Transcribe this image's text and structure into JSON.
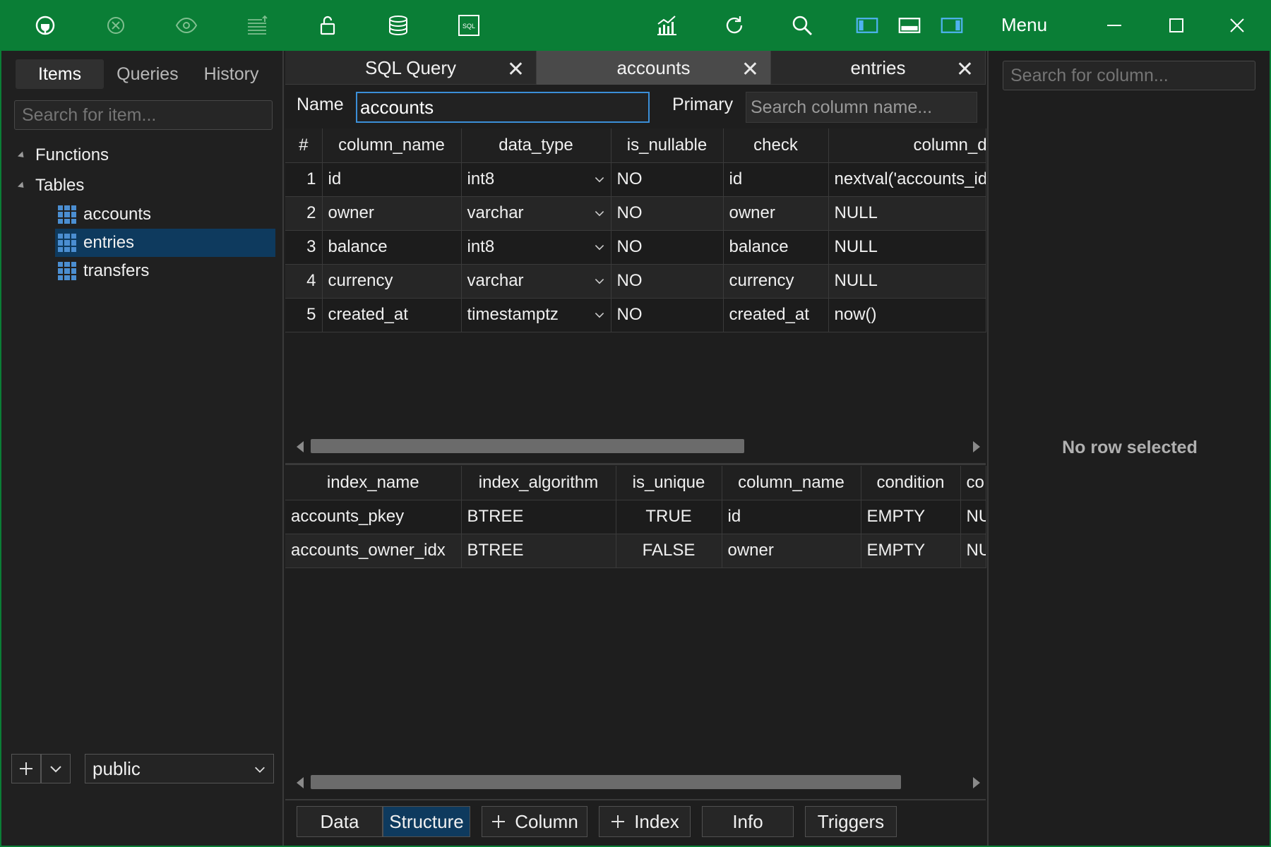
{
  "toolbar": {
    "icons": [
      "connect-icon",
      "disconnect-icon",
      "eye-icon",
      "format-icon",
      "lock-icon",
      "database-icon",
      "sql-icon",
      "chart-icon",
      "refresh-icon",
      "search-icon",
      "layout-left-icon",
      "layout-bottom-icon",
      "layout-right-icon"
    ],
    "sql_text": "SQL",
    "menu_label": "Menu",
    "accent": "#0a7e36"
  },
  "sidebar": {
    "tabs": [
      "Items",
      "Queries",
      "History"
    ],
    "search_placeholder": "Search for item...",
    "groups": [
      {
        "label": "Functions"
      },
      {
        "label": "Tables"
      }
    ],
    "tables": [
      "accounts",
      "entries",
      "transfers"
    ],
    "selected_table": "entries",
    "schema": "public"
  },
  "tabs": [
    {
      "label": "SQL Query"
    },
    {
      "label": "accounts"
    },
    {
      "label": "entries"
    }
  ],
  "structure": {
    "name_label": "Name",
    "name_value": "accounts",
    "primary_label": "Primary",
    "primary_placeholder": "Search column name...",
    "columns_header": [
      "#",
      "column_name",
      "data_type",
      "is_nullable",
      "check",
      "column_d"
    ],
    "columns": [
      {
        "n": "1",
        "name": "id",
        "type": "int8",
        "nullable": "NO",
        "check": "id",
        "default": "nextval('accounts_id_"
      },
      {
        "n": "2",
        "name": "owner",
        "type": "varchar",
        "nullable": "NO",
        "check": "owner",
        "default": "NULL"
      },
      {
        "n": "3",
        "name": "balance",
        "type": "int8",
        "nullable": "NO",
        "check": "balance",
        "default": "NULL"
      },
      {
        "n": "4",
        "name": "currency",
        "type": "varchar",
        "nullable": "NO",
        "check": "currency",
        "default": "NULL"
      },
      {
        "n": "5",
        "name": "created_at",
        "type": "timestamptz",
        "nullable": "NO",
        "check": "created_at",
        "default": "now()"
      }
    ],
    "index_header": [
      "index_name",
      "index_algorithm",
      "is_unique",
      "column_name",
      "condition",
      "co"
    ],
    "indexes": [
      {
        "name": "accounts_pkey",
        "algorithm": "BTREE",
        "unique": "TRUE",
        "column": "id",
        "condition": "EMPTY",
        "extra": "NU"
      },
      {
        "name": "accounts_owner_idx",
        "algorithm": "BTREE",
        "unique": "FALSE",
        "column": "owner",
        "condition": "EMPTY",
        "extra": "NU"
      }
    ]
  },
  "bottom_tabs": {
    "data": "Data",
    "structure": "Structure",
    "column": "Column",
    "index": "Index",
    "info": "Info",
    "triggers": "Triggers"
  },
  "right_panel": {
    "search_placeholder": "Search for column...",
    "empty_message": "No row selected"
  }
}
